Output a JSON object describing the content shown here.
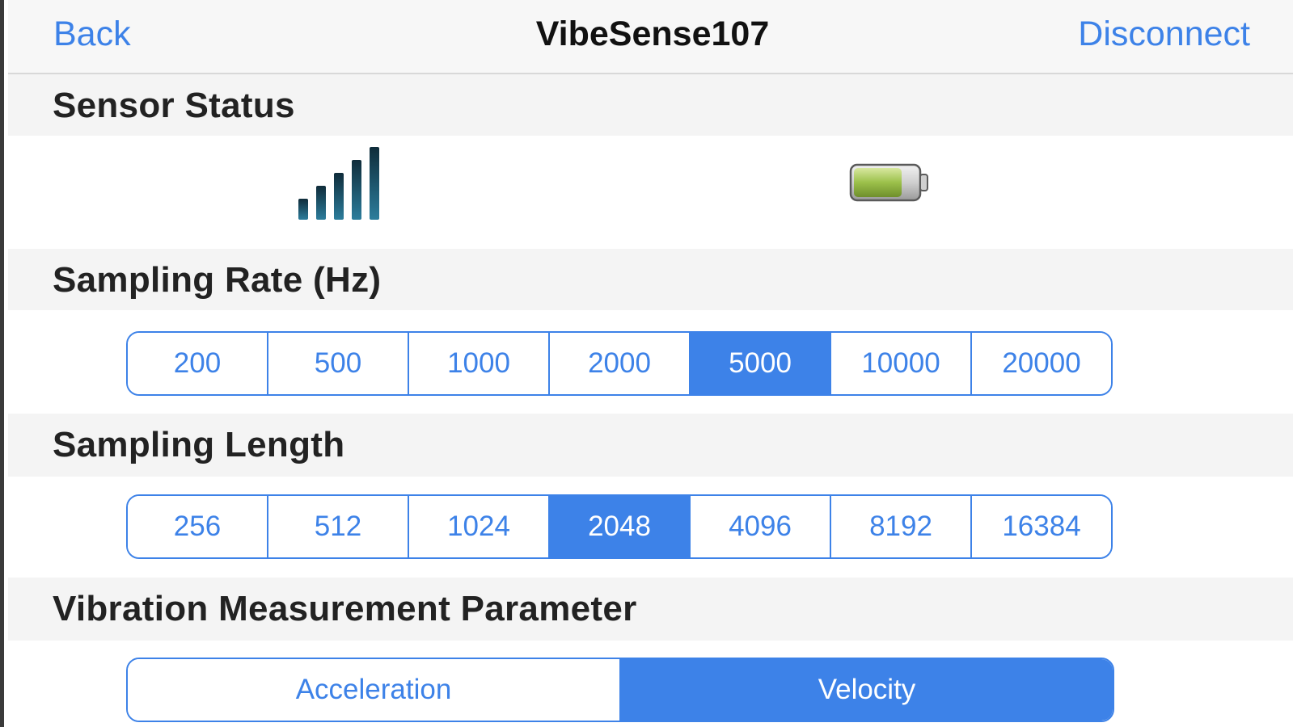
{
  "nav": {
    "back_label": "Back",
    "title": "VibeSense107",
    "disconnect_label": "Disconnect"
  },
  "sensor_status": {
    "header": "Sensor Status",
    "signal_icon": "signal-strength-icon",
    "battery_icon": "battery-icon",
    "signal_bars": 5,
    "battery_level": 0.75
  },
  "sampling_rate": {
    "header": "Sampling Rate (Hz)",
    "options": [
      "200",
      "500",
      "1000",
      "2000",
      "5000",
      "10000",
      "20000"
    ],
    "selected": "5000"
  },
  "sampling_length": {
    "header": "Sampling Length",
    "options": [
      "256",
      "512",
      "1024",
      "2048",
      "4096",
      "8192",
      "16384"
    ],
    "selected": "2048"
  },
  "vibration_parameter": {
    "header": "Vibration Measurement Parameter",
    "options": [
      "Acceleration",
      "Velocity"
    ],
    "selected": "Velocity"
  },
  "colors": {
    "accent": "#3d82e8",
    "section_bg": "#f4f4f4",
    "battery_fill": "#9bc04a",
    "signal_bar": "#1f5f7a"
  }
}
